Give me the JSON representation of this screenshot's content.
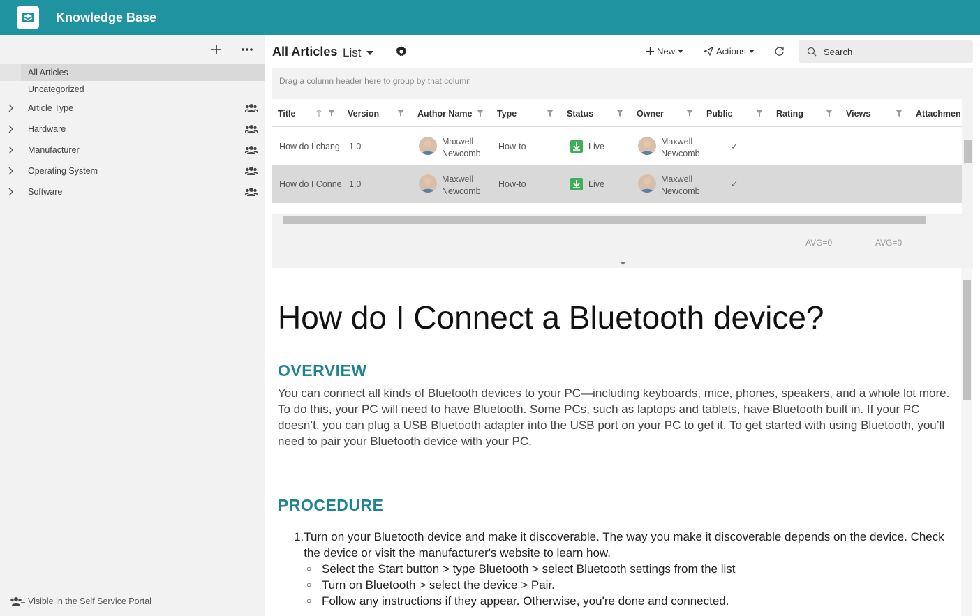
{
  "app": {
    "title": "Knowledge Base"
  },
  "sidebar": {
    "items": [
      {
        "label": "All Articles",
        "active": true
      },
      {
        "label": "Uncategorized"
      }
    ],
    "tree": [
      {
        "label": "Article Type"
      },
      {
        "label": "Hardware"
      },
      {
        "label": "Manufacturer"
      },
      {
        "label": "Operating System"
      },
      {
        "label": "Software"
      }
    ],
    "footer": "Visible in the Self Service Portal"
  },
  "main": {
    "title": "All Articles",
    "view": "List",
    "new_label": "New",
    "actions_label": "Actions",
    "search_placeholder": "Search",
    "group_hint": "Drag a column header here to group by that column",
    "columns": [
      "Title",
      "Version",
      "Author Name",
      "Type",
      "Status",
      "Owner",
      "Public",
      "Rating",
      "Views",
      "Attachmen"
    ],
    "rows": [
      {
        "title": "How do I chang",
        "version": "1.0",
        "author_first": "Maxwell",
        "author_last": "Newcomb",
        "type": "How-to",
        "status": "Live",
        "owner_first": "Maxwell",
        "owner_last": "Newcomb",
        "public": "✓"
      },
      {
        "title": "How do I Conne",
        "version": "1.0",
        "author_first": "Maxwell",
        "author_last": "Newcomb",
        "type": "How-to",
        "status": "Live",
        "owner_first": "Maxwell",
        "owner_last": "Newcomb",
        "public": "✓",
        "selected": true
      }
    ],
    "avg_rating": "AVG=0",
    "avg_views": "AVG=0"
  },
  "article": {
    "title": "How do I Connect a Bluetooth device?",
    "overview_heading": "OVERVIEW",
    "overview_text": "You can connect all kinds of Bluetooth devices to your PC—including keyboards, mice, phones, speakers, and a whole lot more. To do this, your PC will need to have Bluetooth. Some PCs, such as laptops and tablets, have Bluetooth built in. If your PC doesn’t, you can plug a USB Bluetooth adapter into the USB port on your PC to get it. To get started with using Bluetooth, you’ll need to pair your Bluetooth device with your PC.",
    "procedure_heading": "PROCEDURE",
    "step1": "Turn on your Bluetooth device and make it discoverable. The way you make it discoverable depends on the device. Check the device or visit the manufacturer's website to learn how.",
    "substeps": [
      "Select the Start  button > type Bluetooth > select Bluetooth settings from the list",
      "Turn on Bluetooth > select the device > Pair.",
      "Follow any instructions if they appear. Otherwise, you're done and connected."
    ]
  },
  "colors": {
    "brand": "#1f939f",
    "heading": "#1f8491",
    "status_live": "#3eae5a"
  },
  "icons": [
    "logo-icon",
    "plus-icon",
    "more-icon",
    "chevron-right-icon",
    "group-icon",
    "gear-icon",
    "refresh-icon",
    "search-icon",
    "send-icon",
    "filter-icon",
    "sort-up-icon",
    "check-icon"
  ]
}
